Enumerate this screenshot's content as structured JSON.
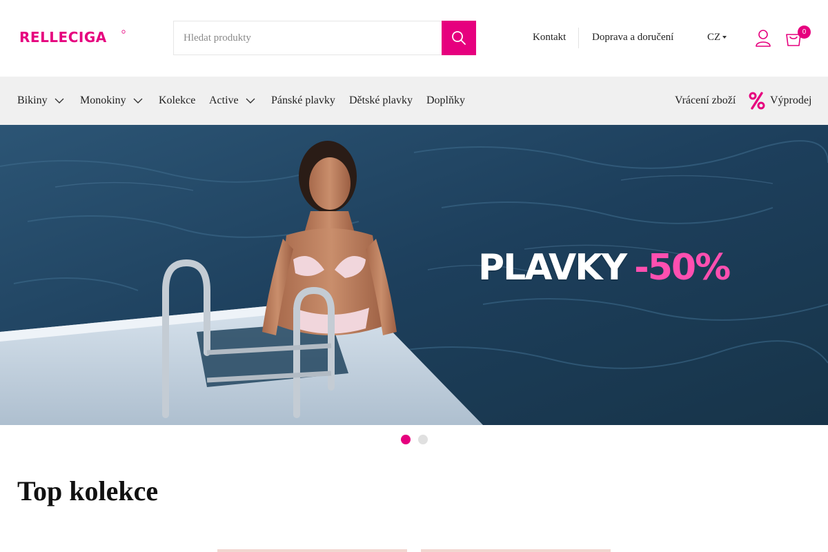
{
  "brand": {
    "name": "RELLECIGA",
    "accent_color": "#e6007e"
  },
  "search": {
    "placeholder": "Hledat produkty",
    "value": ""
  },
  "header_links": [
    "Kontakt",
    "Doprava a doručení"
  ],
  "language": "CZ",
  "cart": {
    "count": "0"
  },
  "icons": {
    "search": "search-icon",
    "user": "user-icon",
    "cart": "shopping-bag-icon",
    "sale": "percent-icon"
  },
  "nav": {
    "items": [
      {
        "label": "Bikiny",
        "has_dropdown": true
      },
      {
        "label": "Monokiny",
        "has_dropdown": true
      },
      {
        "label": "Kolekce",
        "has_dropdown": false
      },
      {
        "label": "Active",
        "has_dropdown": true
      },
      {
        "label": "Pánské plavky",
        "has_dropdown": false
      },
      {
        "label": "Dětské plavky",
        "has_dropdown": false
      },
      {
        "label": "Doplňky",
        "has_dropdown": false
      }
    ],
    "returns": "Vrácení zboží",
    "sale": "Výprodej"
  },
  "hero": {
    "headline": "PLAVKY",
    "discount": "-50%",
    "slides": 2,
    "active_slide": 1
  },
  "sections": {
    "top_collections": "Top kolekce"
  }
}
